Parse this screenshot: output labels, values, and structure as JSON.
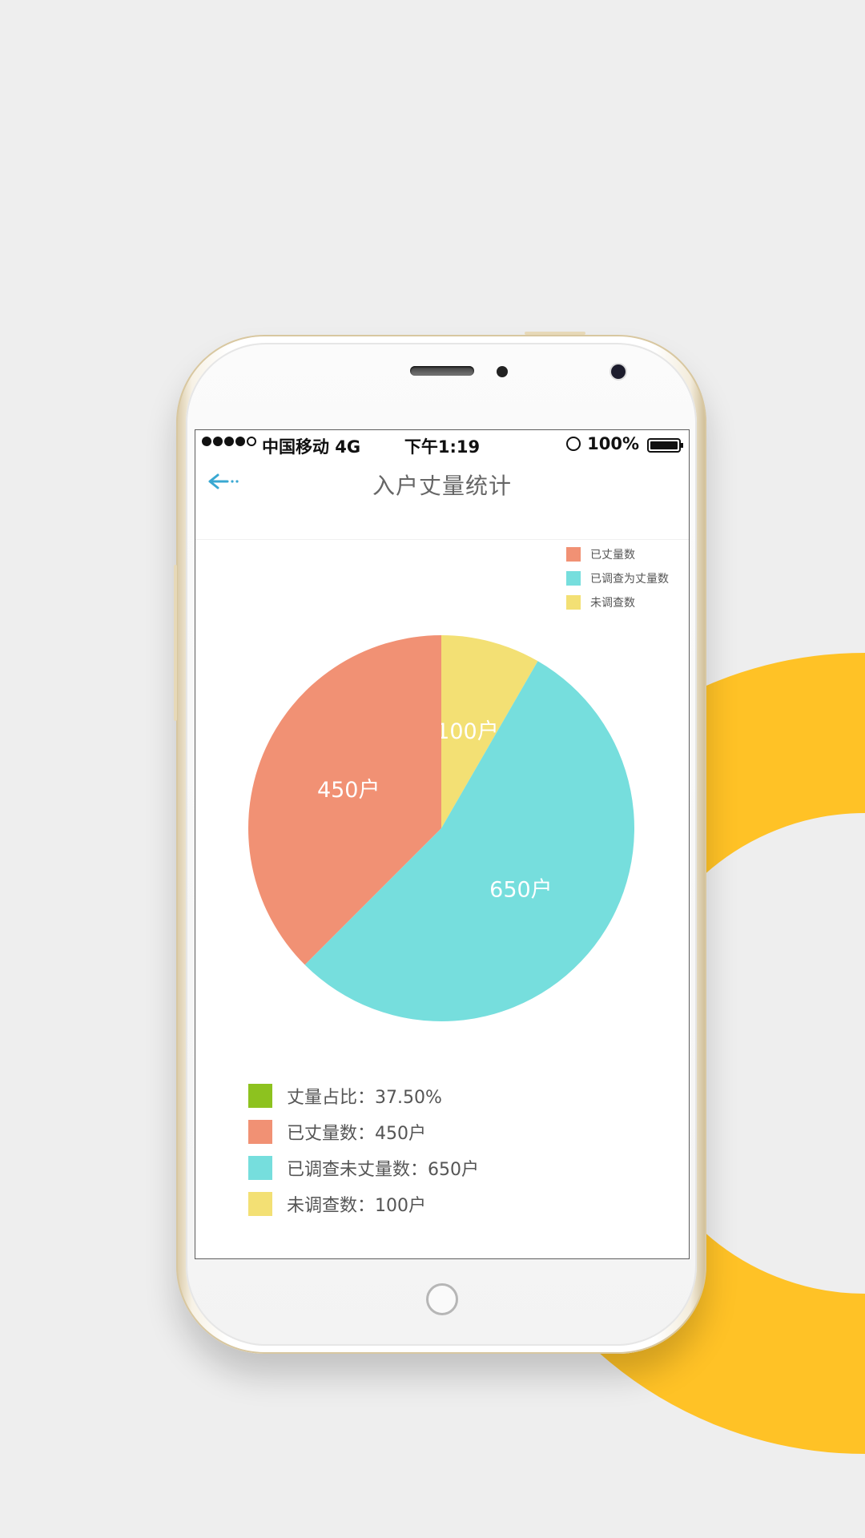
{
  "status_bar": {
    "carrier": "中国移动 4G",
    "time": "下午1:19",
    "battery": "100%"
  },
  "nav": {
    "title": "入户丈量统计"
  },
  "colors": {
    "measured": "#F19174",
    "surveyed": "#76DEDD",
    "not_surveyed": "#F3E074",
    "ratio": "#8DC21F",
    "back": "#39A8D2",
    "decor": "#FFC226"
  },
  "chart_data": {
    "type": "pie",
    "legend_position": "top-right",
    "legend": [
      "已丈量数",
      "已调查为丈量数",
      "未调查数"
    ],
    "slices": [
      {
        "name": "未调查数",
        "value": 100,
        "label": "100户",
        "color": "#F3E074"
      },
      {
        "name": "已调查为丈量数",
        "value": 650,
        "label": "650户",
        "color": "#76DEDD"
      },
      {
        "name": "已丈量数",
        "value": 450,
        "label": "450户",
        "color": "#F19174"
      }
    ]
  },
  "summary": [
    {
      "text": "丈量占比：37.50%",
      "color": "#8DC21F"
    },
    {
      "text": "已丈量数：450户",
      "color": "#F19174"
    },
    {
      "text": "已调查未丈量数：650户",
      "color": "#76DEDD"
    },
    {
      "text": "未调查数：100户",
      "color": "#F3E074"
    }
  ]
}
